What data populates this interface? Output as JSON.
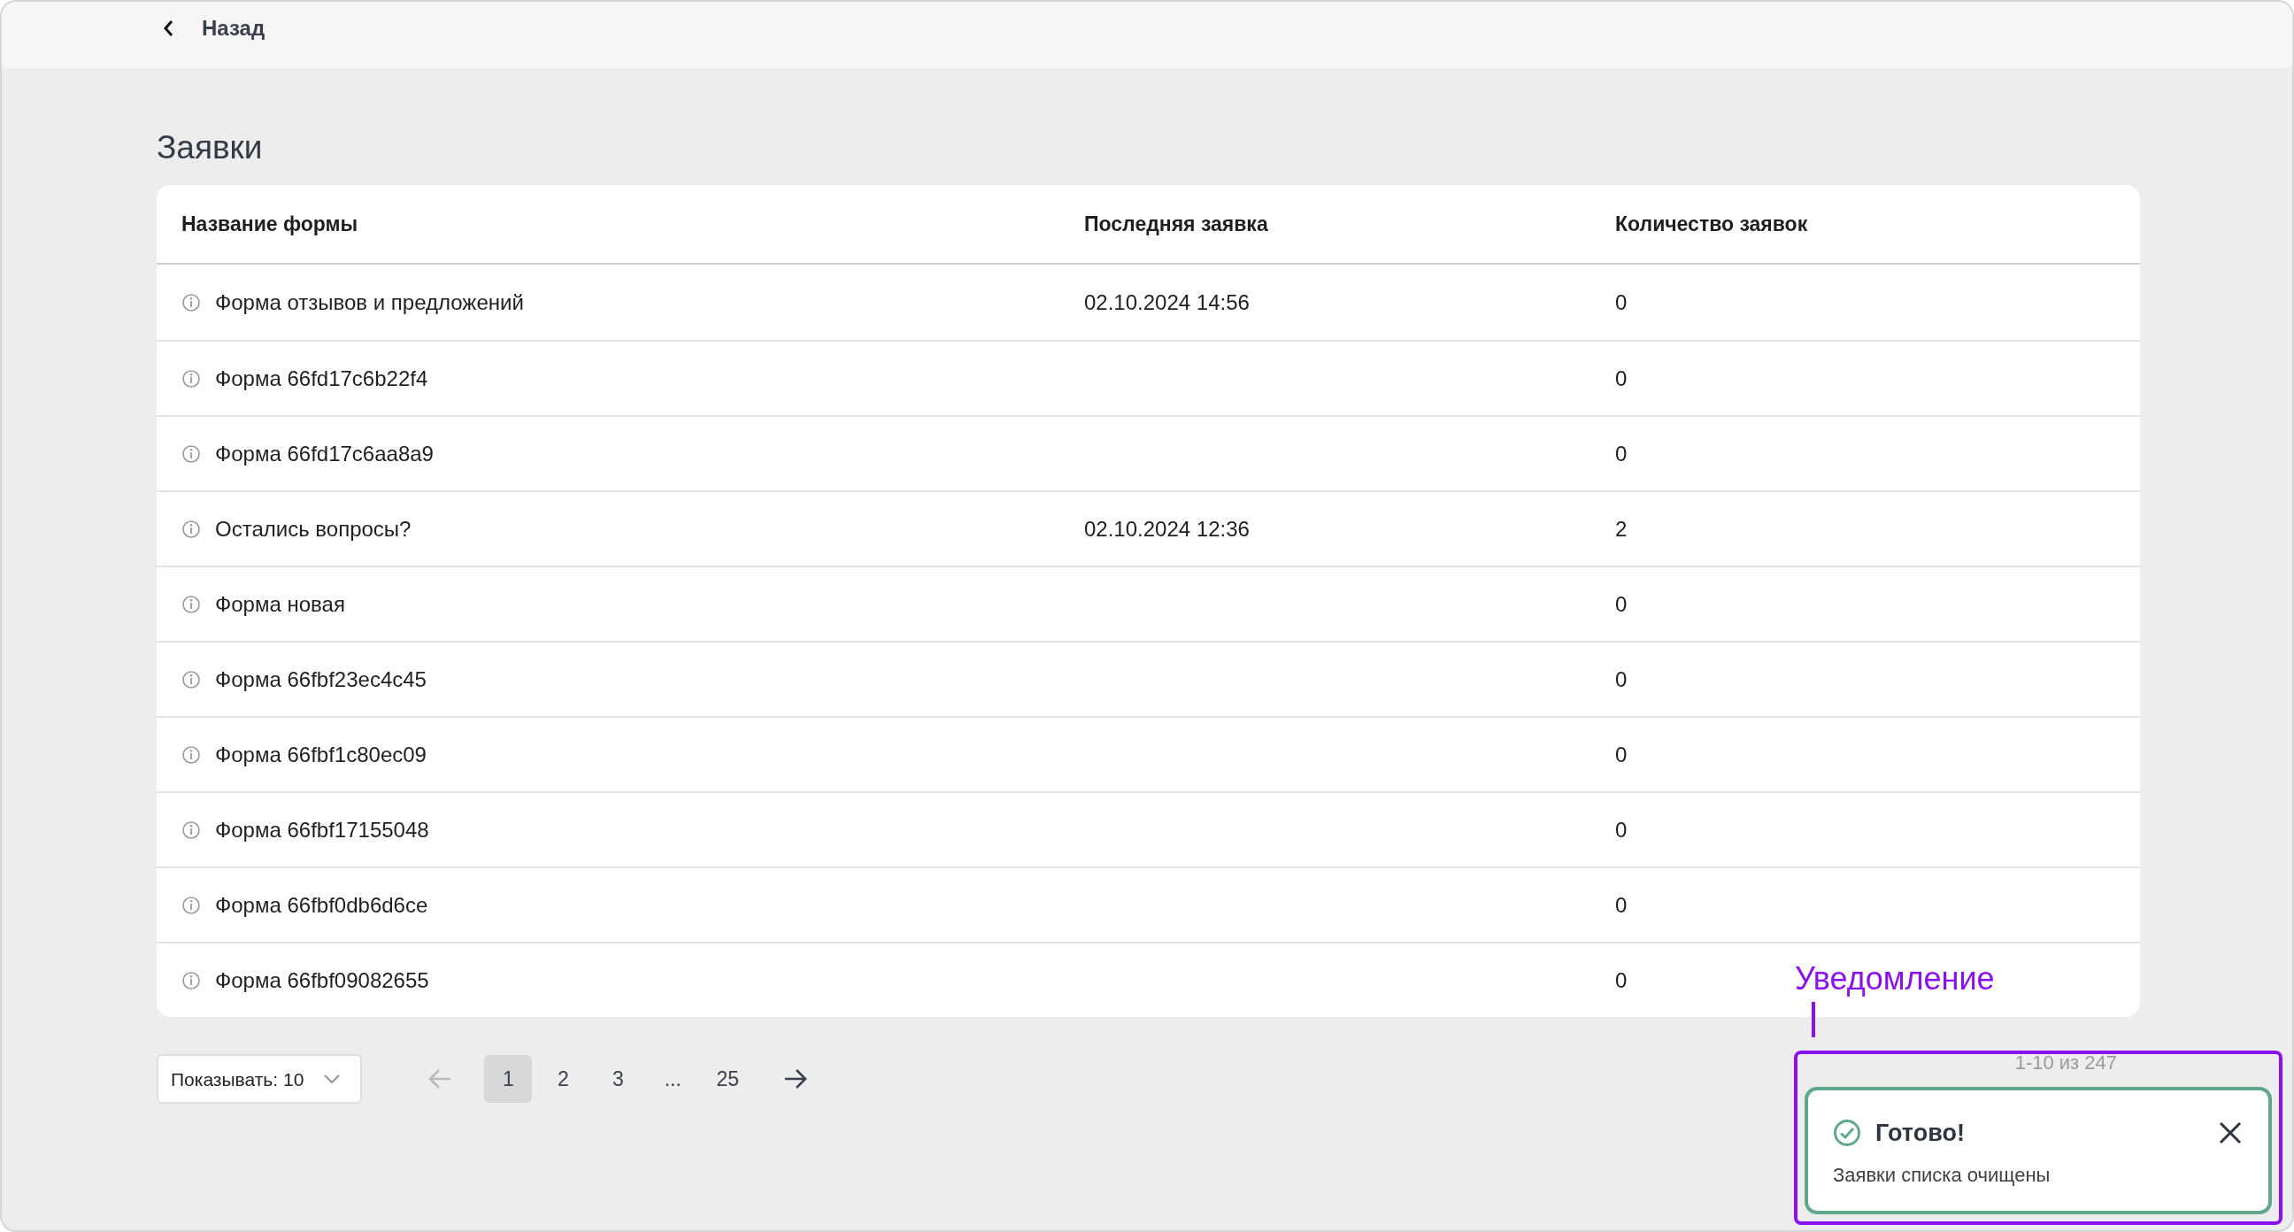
{
  "back_link": {
    "label": "Назад"
  },
  "page_title": "Заявки",
  "table": {
    "columns": [
      "Название формы",
      "Последняя заявка",
      "Количество заявок"
    ],
    "rows": [
      {
        "name": "Форма отзывов и предложений",
        "last_request": "02.10.2024 14:56",
        "count": "0"
      },
      {
        "name": "Форма 66fd17c6b22f4",
        "count": "0"
      },
      {
        "name": "Форма 66fd17c6aa8a9",
        "count": "0"
      },
      {
        "name": "Остались вопросы?",
        "last_request": "02.10.2024 12:36",
        "count": "2"
      },
      {
        "name": "Форма новая",
        "count": "0"
      },
      {
        "name": "Форма 66fbf23ec4c45",
        "count": "0"
      },
      {
        "name": "Форма 66fbf1c80ec09",
        "count": "0"
      },
      {
        "name": "Форма 66fbf17155048",
        "count": "0"
      },
      {
        "name": "Форма 66fbf0db6d6ce",
        "count": "0"
      },
      {
        "name": "Форма 66fbf09082655",
        "count": "0"
      }
    ]
  },
  "pagination": {
    "page_size": "Показывать: 10",
    "prev": {
      "disabled": true
    },
    "pages": [
      {
        "label": "1",
        "selected": true
      },
      {
        "label": "2",
        "selected": false
      },
      {
        "label": "3",
        "selected": false
      },
      {
        "label": "...",
        "selected": false
      },
      {
        "label": "25",
        "selected": false
      }
    ],
    "next": {
      "disabled": false
    },
    "range": "1-10 из 247"
  },
  "toast": {
    "title": "Готово!",
    "message": "Заявки списка очищены"
  },
  "annotation": {
    "label": "Уведомление"
  }
}
